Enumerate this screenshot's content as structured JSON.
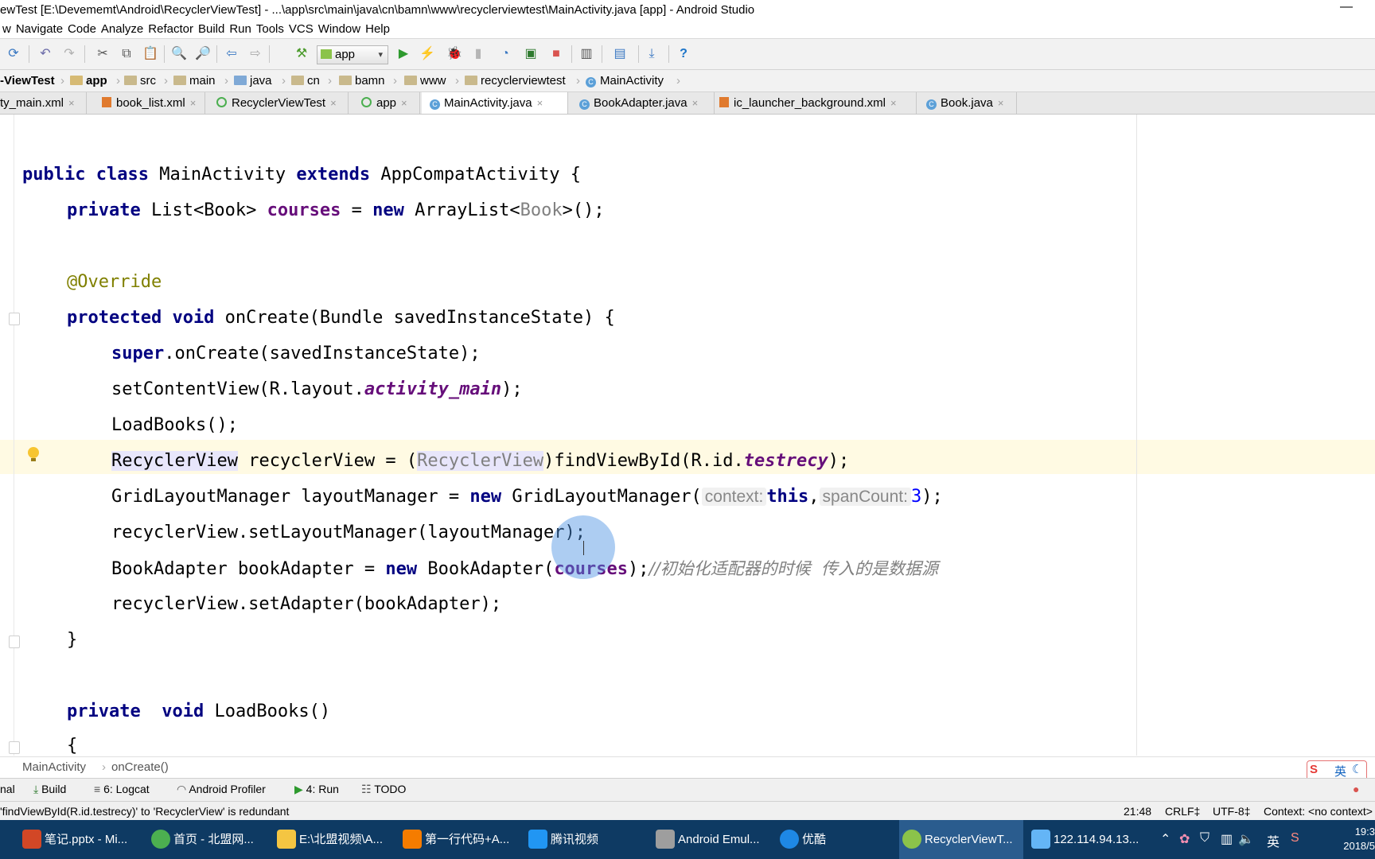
{
  "window": {
    "title": "ewTest [E:\\Devememt\\Android\\RecyclerViewTest] - ...\\app\\src\\main\\java\\cn\\bamn\\www\\recyclerviewtest\\MainActivity.java [app] - Android Studio",
    "minimize": "—"
  },
  "menu": [
    "w",
    "Navigate",
    "Code",
    "Analyze",
    "Refactor",
    "Build",
    "Run",
    "Tools",
    "VCS",
    "Window",
    "Help"
  ],
  "toolbar": {
    "run_config": "app",
    "run_config_arrow": "▾",
    "help": "?"
  },
  "breadcrumb": {
    "project": "-ViewTest",
    "items": [
      "app",
      "src",
      "main",
      "java",
      "cn",
      "bamn",
      "www",
      "recyclerviewtest",
      "MainActivity"
    ],
    "sep": "›"
  },
  "tabs": [
    {
      "label": "ty_main.xml",
      "close": "×"
    },
    {
      "label": "book_list.xml",
      "close": "×"
    },
    {
      "label": "RecyclerViewTest",
      "close": "×"
    },
    {
      "label": "app",
      "close": "×"
    },
    {
      "label": "MainActivity.java",
      "close": "×"
    },
    {
      "label": "BookAdapter.java",
      "close": "×"
    },
    {
      "label": "ic_launcher_background.xml",
      "close": "×"
    },
    {
      "label": "Book.java",
      "close": "×"
    }
  ],
  "code": {
    "l1": {
      "kw1": "public class",
      "t1": " MainActivity ",
      "kw2": "extends",
      "t2": " AppCompatActivity {"
    },
    "l2": {
      "kw1": "private",
      "t1": " List<Book> ",
      "f1": "courses",
      "t2": " = ",
      "kw2": "new",
      "t3": " ArrayList<",
      "g1": "Book",
      "t4": ">();"
    },
    "l3": {
      "ann": "@Override"
    },
    "l4": {
      "kw1": "protected void",
      "t1": " onCreate(Bundle savedInstanceState) {"
    },
    "l5": {
      "kw1": "super",
      "t1": ".onCreate(savedInstanceState);"
    },
    "l6": {
      "t1": "setContentView(R.layout.",
      "i1": "activity_main",
      "t2": ");"
    },
    "l7": {
      "t1": "LoadBooks();"
    },
    "l8": {
      "h1": "RecyclerView",
      "t1": " recyclerView = (",
      "g1": "RecyclerView",
      "t2": ")findViewById(R.id.",
      "i1": "testrecy",
      "t3": ");"
    },
    "l9": {
      "t1": "GridLayoutManager layoutManager = ",
      "kw1": "new",
      "t2": " GridLayoutManager(",
      "hint1": "context:",
      "kw2": "this",
      "t3": ",",
      "hint2": "spanCount:",
      "n1": "3",
      "t4": ");"
    },
    "l10": {
      "t1": "recyclerView.setLayoutManager(layoutManager);"
    },
    "l11": {
      "t1": "BookAdapter bookAdapter = ",
      "kw1": "new",
      "t2": " BookAdapter(",
      "f1": "courses",
      "t3": ");",
      "c1": "//初始化适配器的时候  传入的是数据源"
    },
    "l12": {
      "t1": "recyclerView.setAdapter(bookAdapter);"
    },
    "l13": {
      "t1": "}"
    },
    "l14": {
      "kw1": "private",
      "t1": "  ",
      "kw2": "void",
      "t2": " LoadBooks()"
    },
    "l15": {
      "t1": "{"
    }
  },
  "editor_breadcrumb": {
    "class": "MainActivity",
    "sep": "›",
    "method": "onCreate()"
  },
  "tool_windows": [
    {
      "label": "nal"
    },
    {
      "label": "Build"
    },
    {
      "label": "6: Logcat"
    },
    {
      "label": "Android Profiler"
    },
    {
      "label": "4: Run"
    },
    {
      "label": "TODO"
    }
  ],
  "status": {
    "message": "'findViewById(R.id.testrecy)' to 'RecyclerView' is redundant",
    "position": "21:48",
    "line_sep": "CRLF‡",
    "encoding": "UTF-8‡",
    "context": "Context: <no context>"
  },
  "ime": {
    "label": "英"
  },
  "taskbar": {
    "items": [
      {
        "label": "笔记.pptx - Mi...",
        "color": "#d24726"
      },
      {
        "label": "首页 - 北盟网...",
        "color": "#4caf50"
      },
      {
        "label": "E:\\北盟视频\\A...",
        "color": "#f4c542"
      },
      {
        "label": "第一行代码+A...",
        "color": "#f57c00"
      },
      {
        "label": "腾讯视频",
        "color": "#2196f3"
      },
      {
        "label": "Android Emul...",
        "color": "#9e9e9e"
      },
      {
        "label": "优酷",
        "color": "#1e88e5"
      },
      {
        "label": "RecyclerViewT...",
        "color": "#8bc34a"
      },
      {
        "label": "122.114.94.13...",
        "color": "#64b5f6"
      }
    ],
    "ime": "英",
    "clock_time": "19:3",
    "clock_date": "2018/5"
  }
}
